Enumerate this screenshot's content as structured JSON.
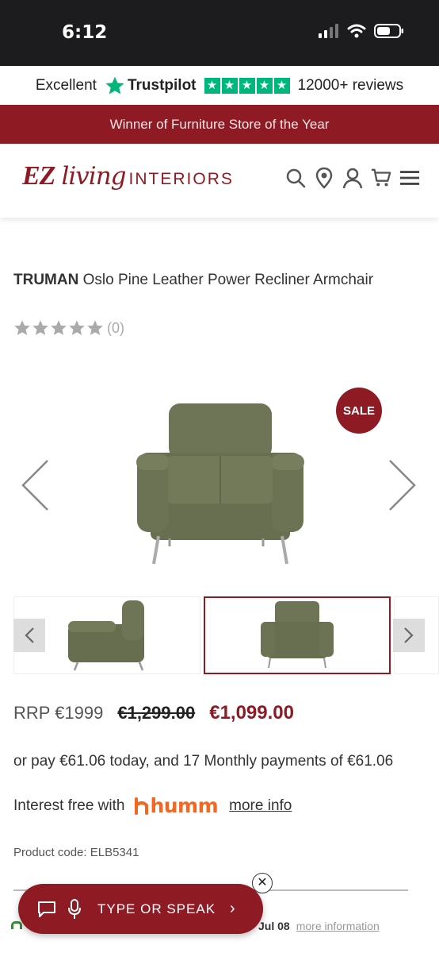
{
  "status_bar": {
    "time": "6:12"
  },
  "trustpilot": {
    "rating_word": "Excellent",
    "brand": "Trustpilot",
    "reviews": "12000+ reviews",
    "star_color": "#00b67a"
  },
  "promo": {
    "text": "Winner of Furniture Store of the Year"
  },
  "header": {
    "logo_part1": "EZ",
    "logo_part2": "living",
    "logo_part3": "INTERIORS",
    "icons": [
      "search-icon",
      "location-icon",
      "account-icon",
      "cart-icon",
      "menu-icon"
    ],
    "brand_color": "#8e1b24"
  },
  "product": {
    "brand": "TRUMAN",
    "name": "Oslo Pine Leather Power Recliner Armchair",
    "rating_count": "(0)",
    "sale_badge": "SALE",
    "rrp": "RRP €1999",
    "was_price": "€1,299.00",
    "price": "€1,099.00",
    "finance_text": "or pay €61.06 today, and 17 Monthly payments of €61.06",
    "interest_free": "Interest free with",
    "humm": "humm",
    "more_info": "more info",
    "product_code": "Product code: ELB5341"
  },
  "delivery": {
    "date": "Jul 08",
    "more": "more information"
  },
  "voice": {
    "label": "TYPE OR SPEAK"
  }
}
